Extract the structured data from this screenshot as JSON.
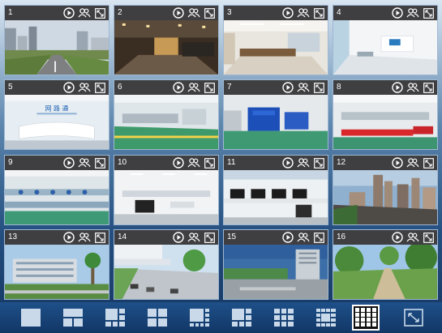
{
  "tiles": [
    {
      "number": "1"
    },
    {
      "number": "2"
    },
    {
      "number": "3"
    },
    {
      "number": "4"
    },
    {
      "number": "5",
      "sign": "网 路 通"
    },
    {
      "number": "6"
    },
    {
      "number": "7"
    },
    {
      "number": "8"
    },
    {
      "number": "9"
    },
    {
      "number": "10"
    },
    {
      "number": "11"
    },
    {
      "number": "12"
    },
    {
      "number": "13"
    },
    {
      "number": "14"
    },
    {
      "number": "15"
    },
    {
      "number": "16"
    }
  ],
  "tile_icons": [
    "play-icon",
    "user-group-icon",
    "fullscreen-icon"
  ],
  "layout_toolbar": {
    "options": [
      "1-split",
      "4-split",
      "6-split",
      "4-split-alt",
      "8-split",
      "9-split",
      "12-split",
      "13-split",
      "16-split"
    ],
    "selected": "16-split",
    "extra": "fullscreen-toggle"
  },
  "colors": {
    "tile_bar": "#3f3f41",
    "toolbar": "#1b4a82",
    "active_border": "#ffffff"
  }
}
